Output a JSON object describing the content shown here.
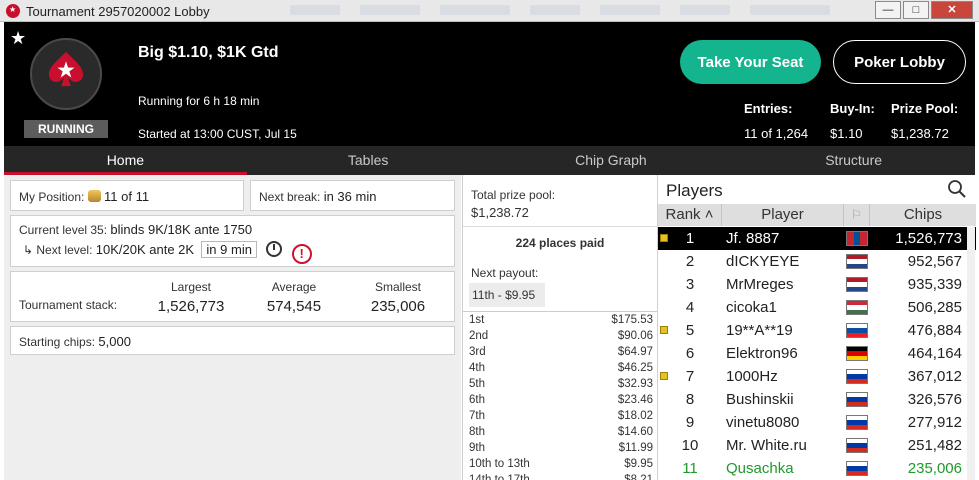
{
  "window": {
    "title": "Tournament 2957020002 Lobby",
    "controls": {
      "minimize": "—",
      "maximize": "□",
      "close": "✕"
    }
  },
  "header": {
    "tournament_name": "Big $1.10, $1K Gtd",
    "status": "RUNNING",
    "running_for": "Running for 6 h 18 min",
    "started_at": "Started at 13:00 CUST, Jul 15",
    "take_seat_label": "Take Your Seat",
    "poker_lobby_label": "Poker Lobby",
    "stats": {
      "entries_label": "Entries:",
      "entries_value": "11 of 1,264",
      "buyin_label": "Buy-In:",
      "buyin_value": "$1.10",
      "prizepool_label": "Prize Pool:",
      "prizepool_value": "$1,238.72"
    }
  },
  "tabs": [
    "Home",
    "Tables",
    "Chip Graph",
    "Structure"
  ],
  "home": {
    "position_label": "My Position:",
    "position_value": "11 of 11",
    "next_break_label": "Next break:",
    "next_break_value": "in 36 min",
    "current_level_label": "Current level 35:",
    "current_level_value": "blinds 9K/18K ante 1750",
    "next_level_label": "↳ Next level:",
    "next_level_value": "10K/20K ante 2K",
    "next_level_time": "in 9 min",
    "stack_label": "Tournament stack:",
    "stack": {
      "largest_label": "Largest",
      "largest_value": "1,526,773",
      "average_label": "Average",
      "average_value": "574,545",
      "smallest_label": "Smallest",
      "smallest_value": "235,006"
    },
    "starting_chips_label": "Starting chips:",
    "starting_chips_value": "5,000"
  },
  "prizes": {
    "total_label": "Total prize pool:",
    "total_value": "$1,238.72",
    "places_paid": "224 places paid",
    "next_payout_label": "Next payout:",
    "next_payout_value": "11th - $9.95",
    "payouts": [
      {
        "place": "1st",
        "amount": "$175.53"
      },
      {
        "place": "2nd",
        "amount": "$90.06"
      },
      {
        "place": "3rd",
        "amount": "$64.97"
      },
      {
        "place": "4th",
        "amount": "$46.25"
      },
      {
        "place": "5th",
        "amount": "$32.93"
      },
      {
        "place": "6th",
        "amount": "$23.46"
      },
      {
        "place": "7th",
        "amount": "$18.02"
      },
      {
        "place": "8th",
        "amount": "$14.60"
      },
      {
        "place": "9th",
        "amount": "$11.99"
      },
      {
        "place": "10th to 13th",
        "amount": "$9.95"
      },
      {
        "place": "14th to 17th",
        "amount": "$8.21"
      }
    ]
  },
  "players": {
    "title": "Players",
    "columns": {
      "rank": "Rank ˄",
      "player": "Player",
      "flag": "⚐",
      "chips": "Chips"
    },
    "rows": [
      {
        "rank": "1",
        "name": "Jf. 8887",
        "chips": "1,526,773",
        "flag": "mongolia"
      },
      {
        "rank": "2",
        "name": "dICKYEYE",
        "chips": "952,567",
        "flag": "netherlands"
      },
      {
        "rank": "3",
        "name": "MrMreges",
        "chips": "935,339",
        "flag": "netherlands"
      },
      {
        "rank": "4",
        "name": "cicoka1",
        "chips": "506,285",
        "flag": "hungary"
      },
      {
        "rank": "5",
        "name": "19**A**19",
        "chips": "476,884",
        "flag": "slovakia"
      },
      {
        "rank": "6",
        "name": "Elektron96",
        "chips": "464,164",
        "flag": "germany"
      },
      {
        "rank": "7",
        "name": "1000Hz",
        "chips": "367,012",
        "flag": "russia"
      },
      {
        "rank": "8",
        "name": "Bushinskii",
        "chips": "326,576",
        "flag": "russia"
      },
      {
        "rank": "9",
        "name": "vinetu8080",
        "chips": "277,912",
        "flag": "russia"
      },
      {
        "rank": "10",
        "name": "Mr. White.ru",
        "chips": "251,482",
        "flag": "russia"
      },
      {
        "rank": "11",
        "name": "Qusachka",
        "chips": "235,006",
        "flag": "russia"
      }
    ]
  },
  "colors": {
    "accent_green": "#14b48f",
    "brand_red": "#c8102e",
    "self_row_green": "#1e9a2b"
  }
}
